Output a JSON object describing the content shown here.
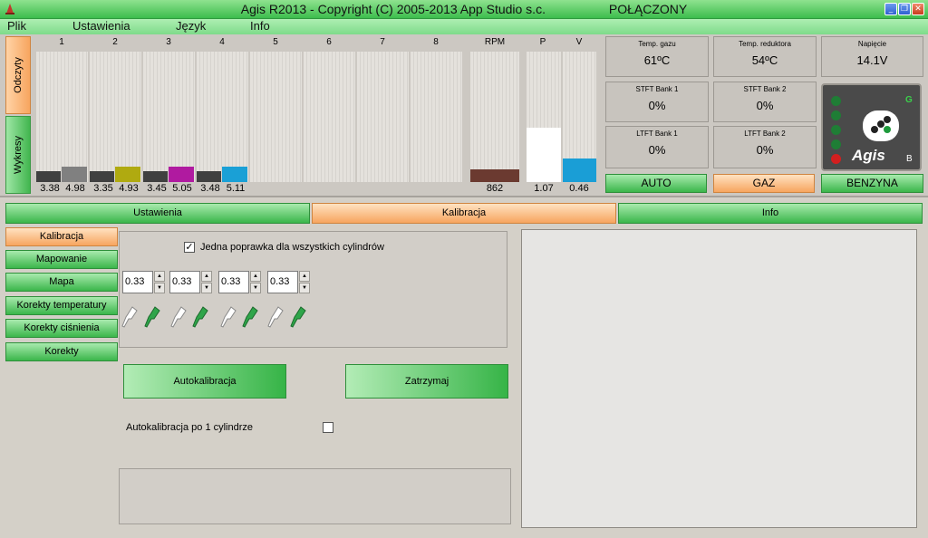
{
  "window": {
    "title": "Agis R2013 - Copyright (C) 2005-2013 App Studio s.c.",
    "status": "POŁĄCZONY"
  },
  "menu": [
    "Plik",
    "Ustawienia",
    "Język",
    "Info"
  ],
  "side_tabs": [
    "Odczyty",
    "Wykresy"
  ],
  "columns": {
    "labels": [
      "1",
      "2",
      "3",
      "4",
      "5",
      "6",
      "7",
      "8",
      "RPM",
      "P",
      "V"
    ]
  },
  "cylinders": [
    {
      "a": "3.38",
      "b": "4.98",
      "a_level": 0.08,
      "b_level": 0.12,
      "b_color": "#808080"
    },
    {
      "a": "3.35",
      "b": "4.93",
      "a_level": 0.08,
      "b_level": 0.12,
      "b_color": "#b0aa10"
    },
    {
      "a": "3.45",
      "b": "5.05",
      "a_level": 0.08,
      "b_level": 0.12,
      "b_color": "#b01aa0"
    },
    {
      "a": "3.48",
      "b": "5.11",
      "a_level": 0.08,
      "b_level": 0.12,
      "b_color": "#1aa0d6"
    }
  ],
  "rpm": {
    "value": "862",
    "level": 0.1
  },
  "p": {
    "value": "1.07",
    "level": 0.42
  },
  "v": {
    "value": "0.46",
    "level": 0.18
  },
  "readouts": [
    {
      "label": "Temp. gazu",
      "value": "61ºC"
    },
    {
      "label": "Temp. reduktora",
      "value": "54ºC"
    },
    {
      "label": "Napięcie",
      "value": "14.1V"
    },
    {
      "label": "STFT Bank 1",
      "value": "0%"
    },
    {
      "label": "STFT Bank 2",
      "value": "0%"
    },
    {
      "label": "LTFT Bank 1",
      "value": "0%"
    },
    {
      "label": "LTFT Bank 2",
      "value": "0%"
    }
  ],
  "mode_buttons": [
    "AUTO",
    "GAZ",
    "BENZYNA"
  ],
  "device": {
    "brand": "Agis",
    "led_g": "G",
    "led_b": "B"
  },
  "main_tabs": [
    "Ustawienia",
    "Kalibracja",
    "Info"
  ],
  "left_nav": [
    "Kalibracja",
    "Mapowanie",
    "Mapa",
    "Korekty temperatury",
    "Korekty ciśnienia",
    "Korekty"
  ],
  "calib": {
    "checkbox_label": "Jedna poprawka dla wszystkich cylindrów",
    "checkbox_checked": true,
    "spinners": [
      "0.33",
      "0.33",
      "0.33",
      "0.33"
    ],
    "autocal_btn": "Autokalibracja",
    "stop_btn": "Zatrzymaj",
    "per_cyl_label": "Autokalibracja po 1 cylindrze",
    "per_cyl_checked": false
  },
  "colors": {
    "accent_green": "#3bb64b",
    "accent_orange": "#f7a55f",
    "rpm_bar": "#6b3a30",
    "p_bar": "#ffffff",
    "v_bar": "#1a9ed6",
    "dark_bar": "#404040"
  }
}
